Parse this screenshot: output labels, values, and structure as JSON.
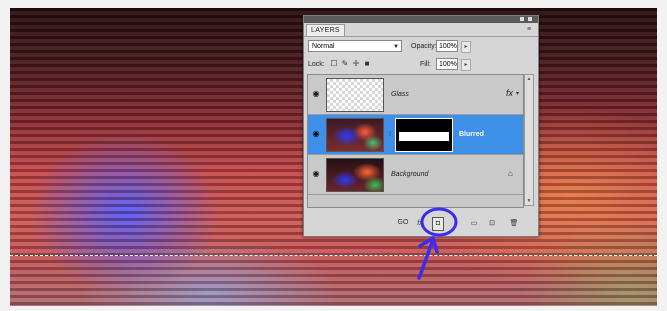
{
  "panel": {
    "tab_label": "LAYERS",
    "menu_glyph": "≡",
    "blend_mode": "Normal",
    "opacity_label": "Opacity:",
    "opacity_value": "100%",
    "lock_label": "Lock:",
    "fill_label": "Fill:",
    "fill_value": "100%"
  },
  "layers": [
    {
      "name": "Glass",
      "thumb": "transparent-checker",
      "has_fx": true,
      "selected": false
    },
    {
      "name": "Blurred",
      "thumb": "colorful-blurred",
      "has_mask": true,
      "selected": true
    },
    {
      "name": "Background",
      "thumb": "colorful",
      "locked": true,
      "selected": false
    }
  ],
  "bottom_bar": {
    "link_label": "GO",
    "fx_label": "fx",
    "icons": [
      "link-layers-icon",
      "layer-style-icon",
      "add-layer-mask-icon",
      "adjustment-layer-icon",
      "new-group-icon",
      "new-layer-icon",
      "trash-icon"
    ]
  },
  "annotation": {
    "color": "#3b2cf0",
    "highlights": "add-layer-mask-button"
  },
  "colors": {
    "selected_row": "#3d8fe8",
    "panel_bg": "#d6d6d6"
  }
}
